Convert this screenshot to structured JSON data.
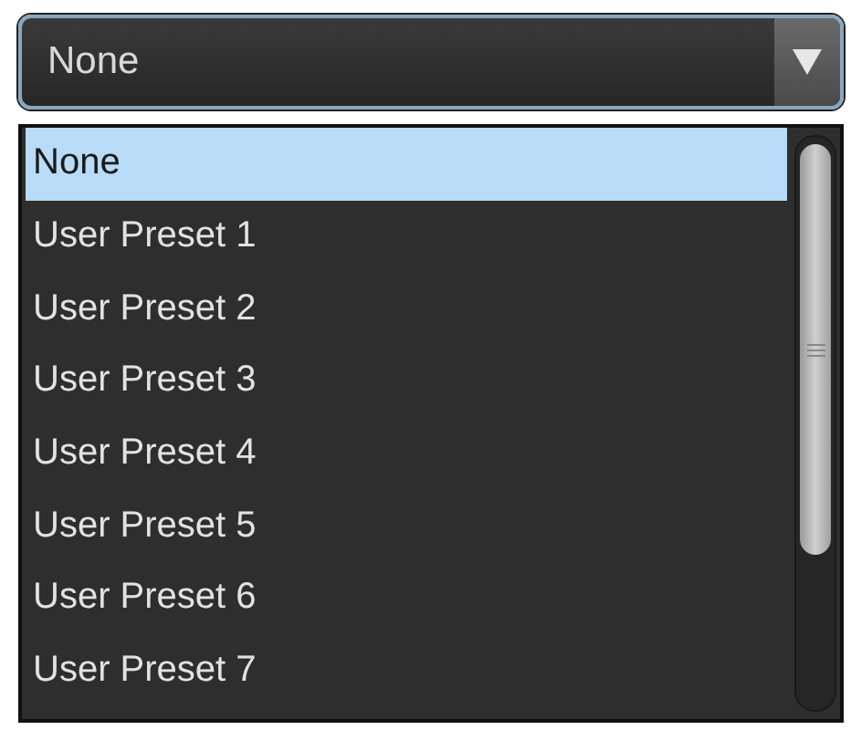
{
  "combo": {
    "value": "None"
  },
  "options": [
    {
      "label": "None",
      "selected": true
    },
    {
      "label": "User Preset 1",
      "selected": false
    },
    {
      "label": "User Preset 2",
      "selected": false
    },
    {
      "label": "User Preset 3",
      "selected": false
    },
    {
      "label": "User Preset 4",
      "selected": false
    },
    {
      "label": "User Preset 5",
      "selected": false
    },
    {
      "label": "User Preset 6",
      "selected": false
    },
    {
      "label": "User Preset 7",
      "selected": false
    }
  ]
}
